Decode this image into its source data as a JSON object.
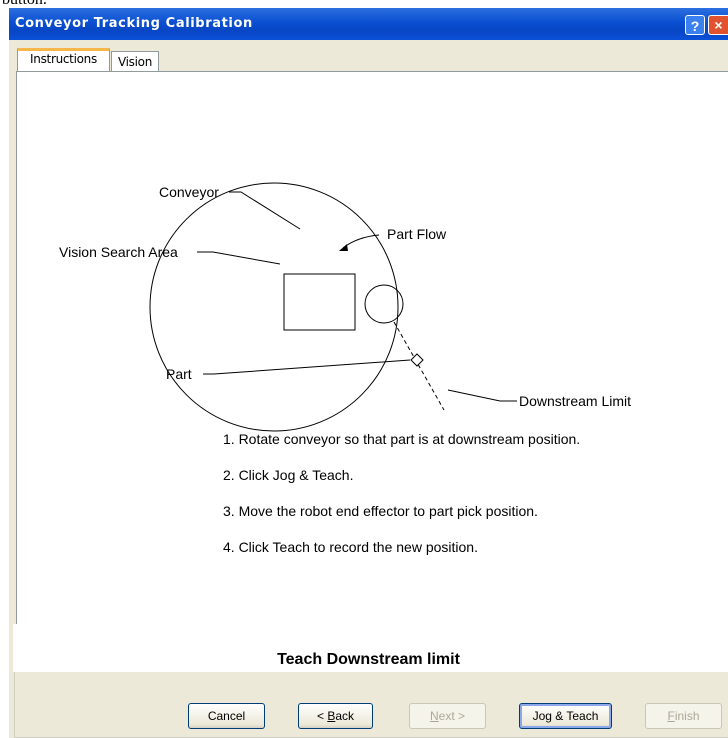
{
  "top_strip_text": "button.",
  "window": {
    "title": "Conveyor Tracking Calibration",
    "help_glyph": "?",
    "close_glyph": "×"
  },
  "tabs": [
    {
      "label": "Instructions",
      "active": true
    },
    {
      "label": "Vision",
      "active": false
    }
  ],
  "diagram": {
    "labels": {
      "conveyor": "Conveyor",
      "part_flow": "Part Flow",
      "vision_search_area": "Vision Search Area",
      "part": "Part",
      "downstream_limit": "Downstream Limit"
    }
  },
  "steps": [
    "1. Rotate conveyor so that part is at downstream position.",
    "2. Click Jog & Teach.",
    "3. Move the robot end effector to part pick position.",
    "4. Click Teach to record the new position."
  ],
  "status": "Teach Downstream limit",
  "buttons": {
    "cancel": "Cancel",
    "back": {
      "prefix": "< ",
      "mnemonic": "B",
      "rest": "ack"
    },
    "next": {
      "mnemonic": "N",
      "rest": "ext >"
    },
    "jog_teach": "Jog & Teach",
    "finish": {
      "mnemonic": "F",
      "rest": "inish"
    }
  },
  "colors": {
    "titlebar": "#0a4fd1",
    "tab_highlight": "#f7b64a",
    "dialog_bg": "#ece9d8",
    "close_button": "#e2522e"
  }
}
